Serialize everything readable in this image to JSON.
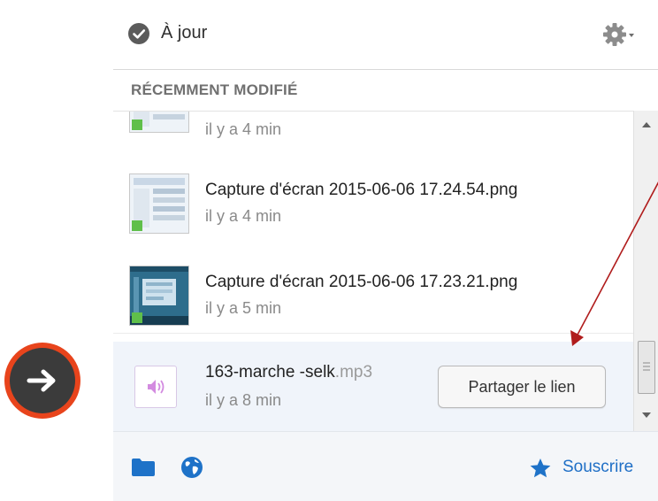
{
  "status": {
    "text": "À jour",
    "icon": "check-circle-icon",
    "settings_icon": "gear-icon"
  },
  "section": {
    "title": "RÉCEMMENT MODIFIÉ"
  },
  "files": [
    {
      "name": "",
      "time": "il y a 4 min"
    },
    {
      "name": "Capture d'écran 2015-06-06 17.24.54.png",
      "time": "il y a 4 min"
    },
    {
      "name": "Capture d'écran 2015-06-06 17.23.21.png",
      "time": "il y a 5 min"
    },
    {
      "name_base": "163-marche -",
      "name_rest": "selk",
      "name_ext": ".mp3",
      "time": "il y a 8 min",
      "share_label": "Partager le lien",
      "icon": "audio-file-icon"
    }
  ],
  "footer": {
    "folder_icon": "folder-icon",
    "globe_icon": "globe-icon",
    "subscribe_label": "Souscrire",
    "subscribe_icon": "star-icon"
  },
  "colors": {
    "accent": "#1f6fc6",
    "arrow_ring": "#e8441c",
    "annotation": "#b01c1c"
  }
}
